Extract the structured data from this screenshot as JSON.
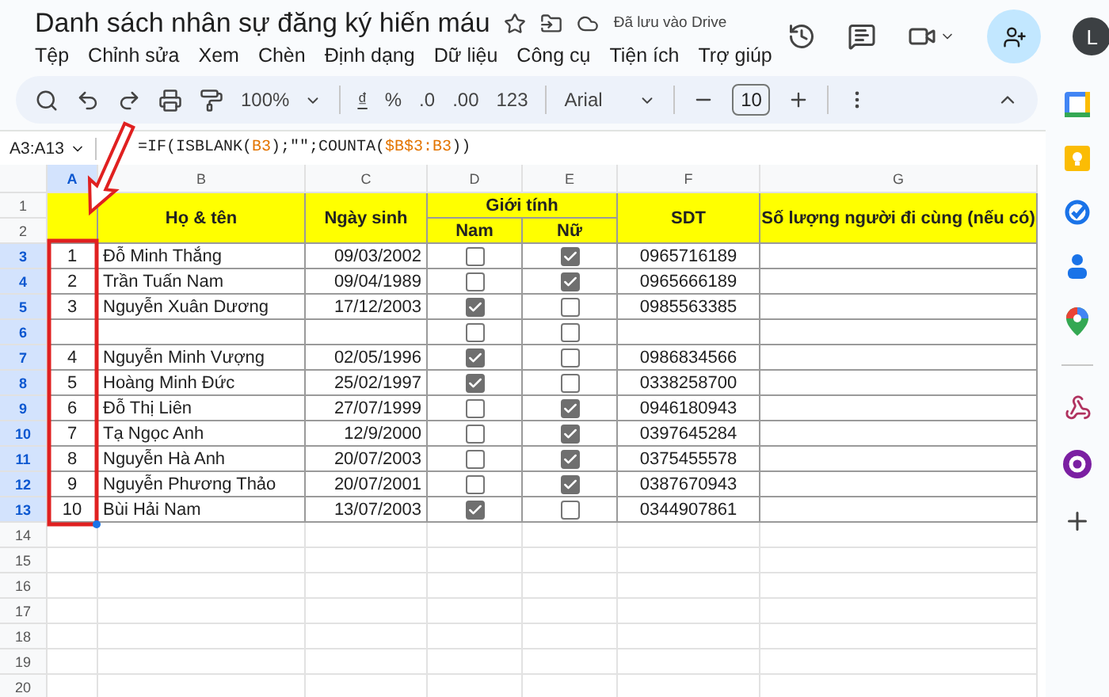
{
  "document": {
    "title": "Danh sách nhân sự đăng ký hiến máu",
    "save_status": "Đã lưu vào Drive",
    "avatar": "L"
  },
  "menu": [
    "Tệp",
    "Chỉnh sửa",
    "Xem",
    "Chèn",
    "Định dạng",
    "Dữ liệu",
    "Công cụ",
    "Tiện ích",
    "Trợ giúp"
  ],
  "toolbar": {
    "zoom": "100%",
    "currency": "₫",
    "percent": "%",
    "decrease_decimals": ".0",
    "increase_decimals": ".00",
    "number_format": "123",
    "font": "Arial",
    "font_size": "10"
  },
  "formula_bar": {
    "name_box": "A3:A13",
    "formula": [
      {
        "kind": "text",
        "text": "=IF(ISBLANK("
      },
      {
        "kind": "ref",
        "text": "B3"
      },
      {
        "kind": "text",
        "text": ");\"\";COUNTA("
      },
      {
        "kind": "ref",
        "text": "$B$3:B3"
      },
      {
        "kind": "text",
        "text": "))"
      }
    ]
  },
  "column_headers": [
    {
      "label": "A",
      "selected": true
    },
    {
      "label": "B",
      "selected": false
    },
    {
      "label": "C",
      "selected": false
    },
    {
      "label": "D",
      "selected": false
    },
    {
      "label": "E",
      "selected": false
    },
    {
      "label": "F",
      "selected": false
    },
    {
      "label": "G",
      "selected": false
    }
  ],
  "row_headers": [
    {
      "label": "1",
      "selected": false
    },
    {
      "label": "2",
      "selected": false
    },
    {
      "label": "3",
      "selected": true
    },
    {
      "label": "4",
      "selected": true
    },
    {
      "label": "5",
      "selected": true
    },
    {
      "label": "6",
      "selected": true
    },
    {
      "label": "7",
      "selected": true
    },
    {
      "label": "8",
      "selected": true
    },
    {
      "label": "9",
      "selected": true
    },
    {
      "label": "10",
      "selected": true
    },
    {
      "label": "11",
      "selected": true
    },
    {
      "label": "12",
      "selected": true
    },
    {
      "label": "13",
      "selected": true
    },
    {
      "label": "14",
      "selected": false
    },
    {
      "label": "15",
      "selected": false
    },
    {
      "label": "16",
      "selected": false
    },
    {
      "label": "17",
      "selected": false
    },
    {
      "label": "18",
      "selected": false
    },
    {
      "label": "19",
      "selected": false
    },
    {
      "label": "20",
      "selected": false
    }
  ],
  "table_header": {
    "name": "Họ & tên",
    "dob": "Ngày sinh",
    "gender": "Giới tính",
    "male": "Nam",
    "female": "Nữ",
    "phone": "SDT",
    "companions": "Số lượng người đi cùng (nếu có)"
  },
  "rows": [
    {
      "stt": "1",
      "name": "Đỗ Minh Thắng",
      "dob": "09/03/2002",
      "male": false,
      "female": true,
      "phone": "0965716189"
    },
    {
      "stt": "2",
      "name": "Trần Tuấn Nam",
      "dob": "09/04/1989",
      "male": false,
      "female": true,
      "phone": "0965666189"
    },
    {
      "stt": "3",
      "name": "Nguyễn Xuân Dương",
      "dob": "17/12/2003",
      "male": true,
      "female": false,
      "phone": "0985563385"
    },
    {
      "male": false,
      "female": false
    },
    {
      "stt": "4",
      "name": "Nguyễn Minh Vượng",
      "dob": "02/05/1996",
      "male": true,
      "female": false,
      "phone": "0986834566"
    },
    {
      "stt": "5",
      "name": "Hoàng Minh Đức",
      "dob": "25/02/1997",
      "male": true,
      "female": false,
      "phone": "0338258700"
    },
    {
      "stt": "6",
      "name": "Đỗ Thị Liên",
      "dob": "27/07/1999",
      "male": false,
      "female": true,
      "phone": "0946180943"
    },
    {
      "stt": "7",
      "name": "Tạ Ngọc Anh",
      "dob": "12/9/2000",
      "male": false,
      "female": true,
      "phone": "0397645284"
    },
    {
      "stt": "8",
      "name": "Nguyễn Hà Anh",
      "dob": "20/07/2003",
      "male": false,
      "female": true,
      "phone": "0375455578"
    },
    {
      "stt": "9",
      "name": "Nguyễn Phương Thảo",
      "dob": "20/07/2001",
      "male": false,
      "female": true,
      "phone": "0387670943"
    },
    {
      "stt": "10",
      "name": "Bùi Hải Nam",
      "dob": "13/07/2003",
      "male": true,
      "female": false,
      "phone": "0344907861"
    }
  ]
}
